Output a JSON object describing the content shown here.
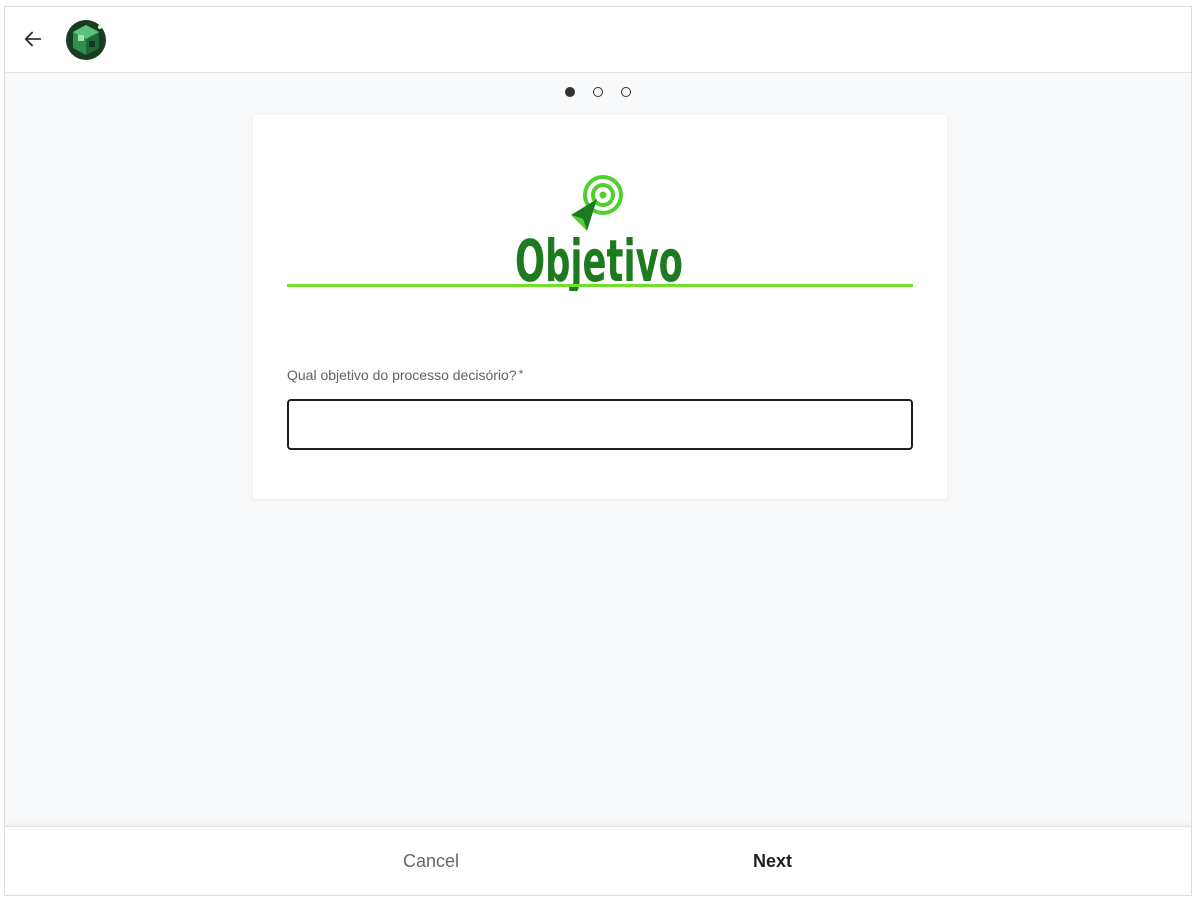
{
  "header": {
    "back_icon": "arrow-left-icon",
    "logo_icon": "app-cube-logo"
  },
  "stepper": {
    "total_steps": 3,
    "current_step": 1
  },
  "card": {
    "banner": {
      "title": "Objetivo",
      "icon": "target-arrow-icon",
      "title_color": "#1e7a1e",
      "accent_color": "#6fe02a"
    },
    "field": {
      "label": "Qual objetivo do processo decisório?",
      "required_mark": "*",
      "value": "",
      "placeholder": ""
    }
  },
  "footer": {
    "cancel_label": "Cancel",
    "next_label": "Next"
  }
}
